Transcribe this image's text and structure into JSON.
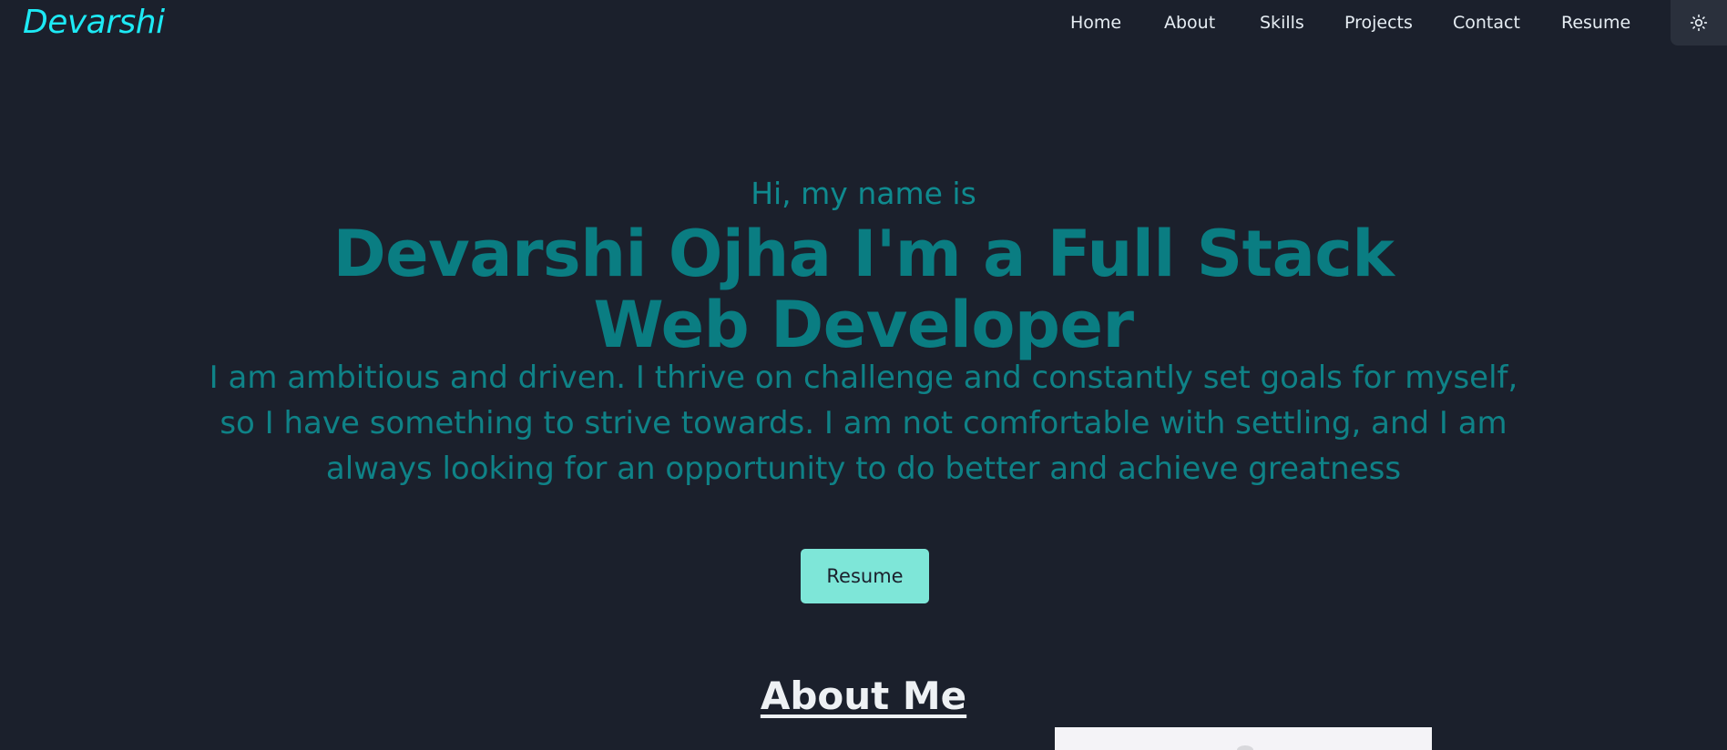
{
  "nav": {
    "logo": "Devarshi",
    "links": [
      "Home",
      "About",
      "Skills",
      "Projects",
      "Contact",
      "Resume"
    ],
    "theme_icon": "sun-icon"
  },
  "hero": {
    "greeting": "Hi, my name is",
    "headline": "Devarshi Ojha I'm a Full Stack Web Developer",
    "bio": "I am ambitious and driven. I thrive on challenge and constantly set goals for myself, so I have something to strive towards. I am not comfortable with settling, and I am always looking for an opportunity to do better and achieve greatness",
    "resume_button": "Resume"
  },
  "about": {
    "title": "About Me"
  },
  "colors": {
    "background": "#1b202c",
    "logo": "#1de9f4",
    "accent_text": "#0a7d82",
    "button_bg": "#7ee6d8"
  }
}
